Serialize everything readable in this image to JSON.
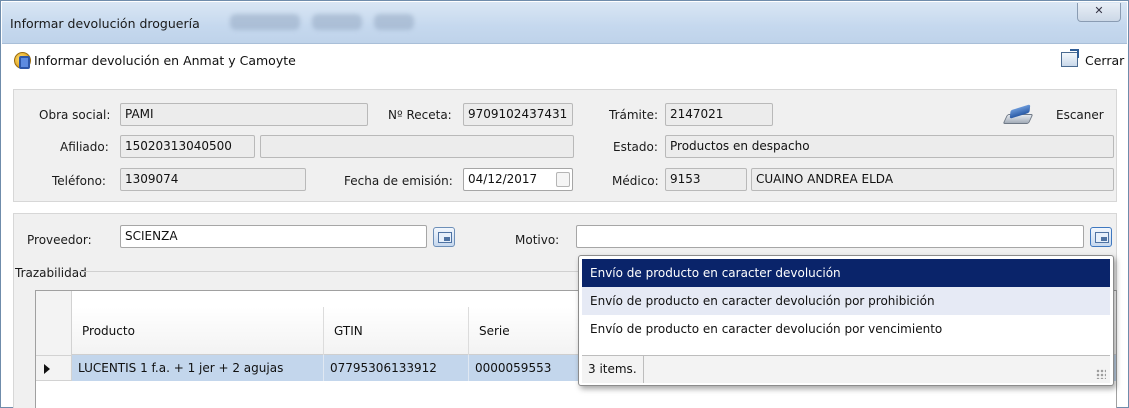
{
  "window": {
    "title": "Informar devolución droguería",
    "close_glyph": "✕"
  },
  "header": {
    "title": "Informar devolución en Anmat y Camoyte",
    "close_label": "Cerrar"
  },
  "form": {
    "obra_social_label": "Obra social:",
    "obra_social_value": "PAMI",
    "receta_label": "Nº Receta:",
    "receta_value": "9709102437431",
    "tramite_label": "Trámite:",
    "tramite_value": "2147021",
    "scan_label": "Escaner",
    "afiliado_label": "Afiliado:",
    "afiliado_value": "15020313040500",
    "afiliado_name": "",
    "estado_label": "Estado:",
    "estado_value": "Productos en despacho",
    "telefono_label": "Teléfono:",
    "telefono_value": "1309074",
    "fecha_label": "Fecha de emisión:",
    "fecha_value": "04/12/2017",
    "medico_label": "Médico:",
    "medico_code": "9153",
    "medico_name": "CUAINO ANDREA ELDA"
  },
  "devolucion": {
    "proveedor_label": "Proveedor:",
    "proveedor_value": "SCIENZA",
    "motivo_label": "Motivo:",
    "motivo_value": ""
  },
  "trazabilidad": {
    "section_label": "Trazabilidad",
    "columns": [
      "Producto",
      "GTIN",
      "Serie"
    ],
    "rows": [
      [
        "LUCENTIS 1 f.a. + 1 jer + 2 agujas",
        "07795306133912",
        "0000059553"
      ]
    ]
  },
  "motivo_dropdown": {
    "options": [
      "Envío de producto en caracter devolución",
      "Envío de producto en caracter devolución por prohibición",
      "Envío de producto en caracter devolución por vencimiento"
    ],
    "selected_index": 0,
    "count_label": "3 items."
  }
}
